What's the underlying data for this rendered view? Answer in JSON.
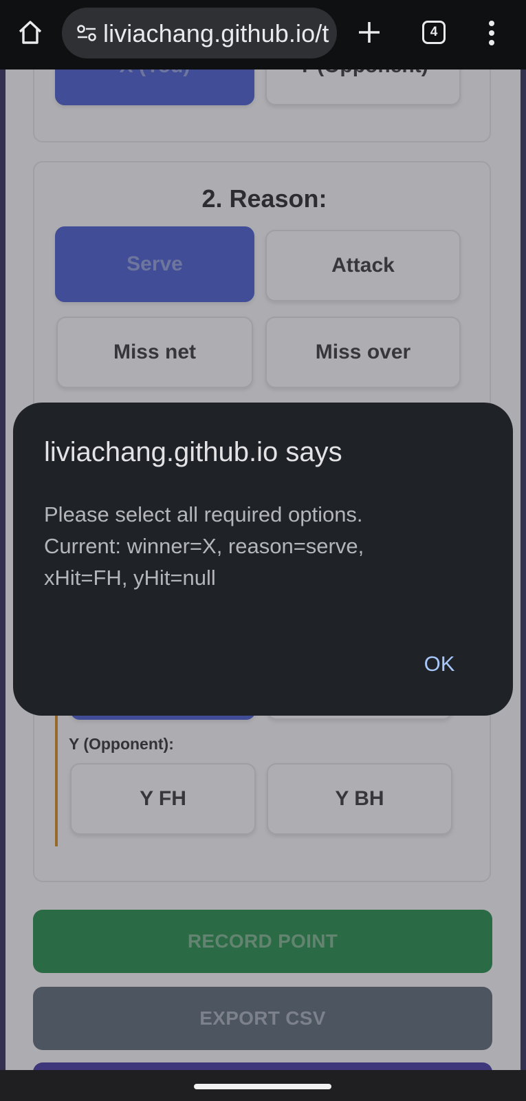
{
  "browser": {
    "url": "liviachang.github.io/t",
    "tab_count": "4",
    "icons": [
      "home-icon",
      "site-settings-icon",
      "new-tab-icon",
      "more-vert-icon"
    ]
  },
  "page": {
    "winner_section": {
      "options": [
        "X (You)",
        "Y (Opponent)"
      ],
      "selected": "X (You)"
    },
    "reason_section": {
      "title": "2. Reason:",
      "options": [
        "Serve",
        "Attack",
        "Miss net",
        "Miss over"
      ],
      "selected": "Serve"
    },
    "hit_section": {
      "y_label": "Y (Opponent):",
      "y_options": [
        "Y FH",
        "Y BH"
      ]
    },
    "record_button": "RECORD POINT",
    "export_button": "EXPORT CSV"
  },
  "dialog": {
    "title": "liviachang.github.io says",
    "message_lines": [
      "Please select all required options.",
      "Current: winner=X, reason=serve,",
      "xHit=FH, yHit=null"
    ],
    "ok_label": "OK"
  },
  "colors": {
    "selected_button": "#4d5fc8",
    "record_button": "#2b8a4e",
    "export_button": "#5f6b7a",
    "dialog_bg": "#1f2227",
    "dialog_action": "#a8c7fa",
    "hit_accent": "#c98a28"
  }
}
